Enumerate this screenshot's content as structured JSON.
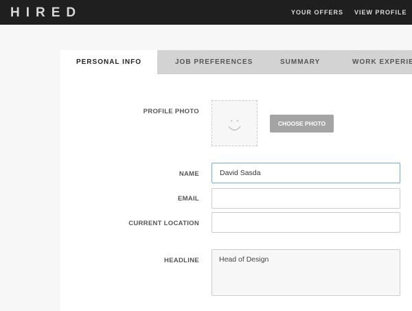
{
  "header": {
    "logo": "HIRED",
    "nav": [
      "YOUR OFFERS",
      "VIEW PROFILE"
    ]
  },
  "tabs": [
    "PERSONAL INFO",
    "JOB PREFERENCES",
    "SUMMARY",
    "WORK EXPERIENCE"
  ],
  "form": {
    "profile_photo_label": "PROFILE PHOTO",
    "choose_photo": "CHOOSE PHOTO",
    "name_label": "NAME",
    "name_value": "David Sasda",
    "email_label": "EMAIL",
    "email_value": "",
    "location_label": "CURRENT LOCATION",
    "location_value": "",
    "headline_label": "HEADLINE",
    "headline_value": "Head of Design"
  }
}
